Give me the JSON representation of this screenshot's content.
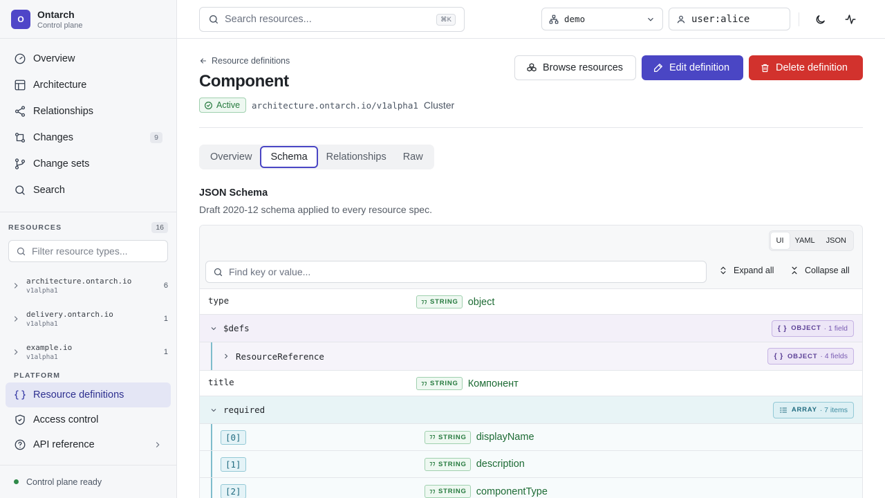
{
  "brand": {
    "logo": "O",
    "name": "Ontarch",
    "subtitle": "Control plane"
  },
  "nav": [
    {
      "label": "Overview",
      "icon": "gauge-icon"
    },
    {
      "label": "Architecture",
      "icon": "layout-icon"
    },
    {
      "label": "Relationships",
      "icon": "share-icon"
    },
    {
      "label": "Changes",
      "icon": "git-compare-icon",
      "badge": "9"
    },
    {
      "label": "Change sets",
      "icon": "git-branch-icon"
    },
    {
      "label": "Search",
      "icon": "search-icon"
    }
  ],
  "resources": {
    "heading": "RESOURCES",
    "count": "16",
    "filter_placeholder": "Filter resource types...",
    "groups": [
      {
        "name": "architecture.ontarch.io",
        "version": "v1alpha1",
        "count": "6"
      },
      {
        "name": "delivery.ontarch.io",
        "version": "v1alpha1",
        "count": "1"
      },
      {
        "name": "example.io",
        "version": "v1alpha1",
        "count": "1"
      }
    ]
  },
  "platform": {
    "heading": "PLATFORM",
    "items": [
      {
        "label": "Resource definitions",
        "icon": "braces-icon"
      },
      {
        "label": "Access control",
        "icon": "shield-icon"
      },
      {
        "label": "API reference",
        "icon": "help-circle-icon"
      }
    ]
  },
  "footer": {
    "status": "Control plane ready"
  },
  "topbar": {
    "search_placeholder": "Search resources...",
    "shortcut": "⌘K",
    "environment": "demo",
    "user": "user:alice"
  },
  "page": {
    "breadcrumb": "Resource definitions",
    "title": "Component",
    "status": "Active",
    "api_version": "architecture.ontarch.io/v1alpha1",
    "scope": "Cluster",
    "actions": {
      "browse": "Browse resources",
      "edit": "Edit definition",
      "delete": "Delete definition"
    },
    "tabs": [
      "Overview",
      "Schema",
      "Relationships",
      "Raw"
    ],
    "active_tab": "Schema"
  },
  "schema": {
    "title": "JSON Schema",
    "description": "Draft 2020-12 schema applied to every resource spec.",
    "view_modes": [
      "UI",
      "YAML",
      "JSON"
    ],
    "active_view": "UI",
    "find_placeholder": "Find key or value...",
    "expand_all": "Expand all",
    "collapse_all": "Collapse all",
    "rows": {
      "type": {
        "key": "type",
        "type": "STRING",
        "value": "object"
      },
      "defs": {
        "key": "$defs",
        "type": "OBJECT",
        "info": "· 1 field"
      },
      "resource_ref": {
        "key": "ResourceReference",
        "type": "OBJECT",
        "info": "· 4 fields"
      },
      "title": {
        "key": "title",
        "type": "STRING",
        "value": "Компонент"
      },
      "required": {
        "key": "required",
        "type": "ARRAY",
        "info": "· 7 items"
      },
      "items": [
        {
          "index": "[0]",
          "type": "STRING",
          "value": "displayName"
        },
        {
          "index": "[1]",
          "type": "STRING",
          "value": "description"
        },
        {
          "index": "[2]",
          "type": "STRING",
          "value": "componentType"
        }
      ]
    }
  },
  "colors": {
    "accent": "#4a46c4",
    "danger": "#d2322d",
    "success": "#267a3e",
    "object_tint": "#f3f0f9",
    "array_tint": "#e8f4f6"
  }
}
